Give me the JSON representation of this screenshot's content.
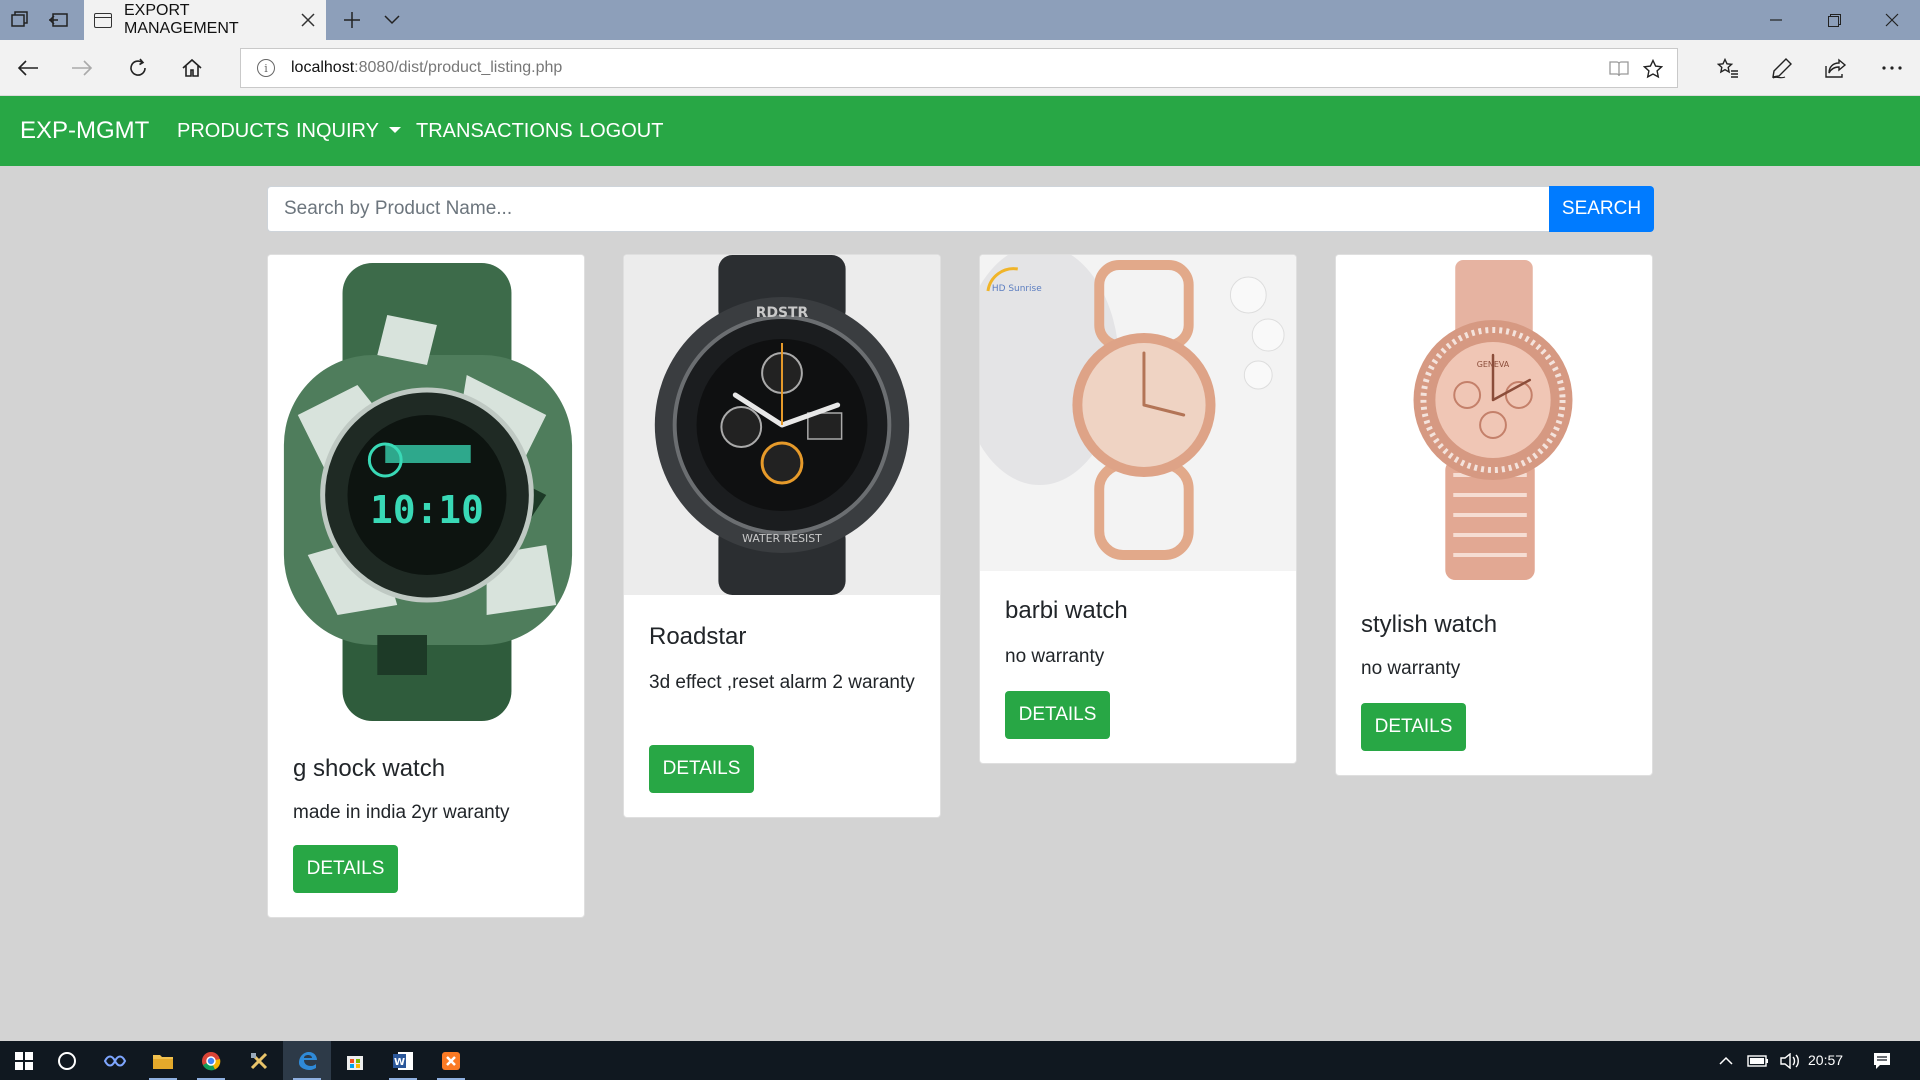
{
  "browser": {
    "tab_title": "EXPORT MANAGEMENT",
    "url_host": "localhost",
    "url_rest": ":8080/dist/product_listing.php"
  },
  "app": {
    "brand": "EXP-MGMT",
    "nav": {
      "products": "PRODUCTS",
      "inquiry": "INQUIRY",
      "transactions": "TRANSACTIONS",
      "logout": "LOGOUT"
    }
  },
  "search": {
    "placeholder": "Search by Product Name...",
    "button": "SEARCH"
  },
  "products": [
    {
      "name": "g shock watch",
      "description": "made in india 2yr waranty",
      "button": "DETAILS"
    },
    {
      "name": "Roadstar",
      "description": "3d effect ,reset alarm 2 waranty",
      "button": "DETAILS"
    },
    {
      "name": "barbi watch",
      "description": "no warranty",
      "button": "DETAILS"
    },
    {
      "name": "stylish watch",
      "description": "no warranty",
      "button": "DETAILS"
    }
  ],
  "taskbar": {
    "clock": "20:57"
  },
  "colors": {
    "navbar": "#28a745",
    "search_button": "#007bff",
    "page_background": "#d3d3d3"
  }
}
